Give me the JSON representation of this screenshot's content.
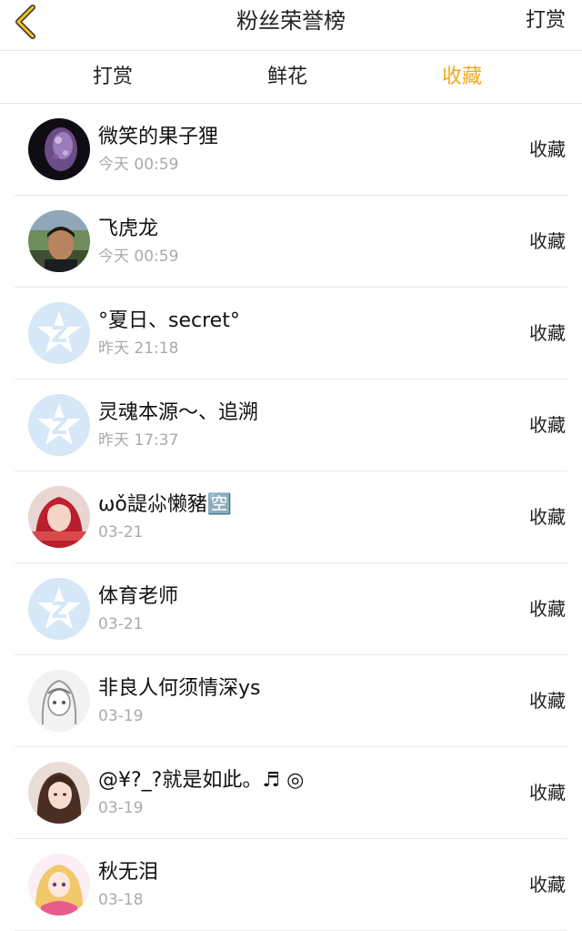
{
  "navbar": {
    "title": "粉丝荣誉榜",
    "right_label": "打赏",
    "back_icon": "chevron-left-icon",
    "accent": "#f2a81d"
  },
  "tabs": [
    {
      "label": "打赏",
      "active": false
    },
    {
      "label": "鲜花",
      "active": false
    },
    {
      "label": "收藏",
      "active": true
    }
  ],
  "fans": [
    {
      "name": "微笑的果子狸",
      "time": "今天 00:59",
      "action": "收藏",
      "avatar": "purple-crystal-photo"
    },
    {
      "name": "飞虎龙",
      "time": "今天 00:59",
      "action": "收藏",
      "avatar": "man-portrait-photo"
    },
    {
      "name": "°夏日、secret°",
      "time": "昨天 21:18",
      "action": "收藏",
      "avatar": "qq-default-avatar"
    },
    {
      "name": "灵魂本源～、追溯",
      "time": "昨天 17:37",
      "action": "收藏",
      "avatar": "qq-default-avatar"
    },
    {
      "name": "ωǒ諟尛懒豬🈳",
      "time": "03-21",
      "action": "收藏",
      "avatar": "red-hair-girl-photo"
    },
    {
      "name": "体育老师",
      "time": "03-21",
      "action": "收藏",
      "avatar": "qq-default-avatar"
    },
    {
      "name": "非良人何须情深ys",
      "time": "03-19",
      "action": "收藏",
      "avatar": "anime-sketch-photo"
    },
    {
      "name": "@¥?_?就是如此。♬ ◎",
      "time": "03-19",
      "action": "收藏",
      "avatar": "girl-portrait-photo"
    },
    {
      "name": "秋无泪",
      "time": "03-18",
      "action": "收藏",
      "avatar": "anime-pink-photo"
    }
  ]
}
